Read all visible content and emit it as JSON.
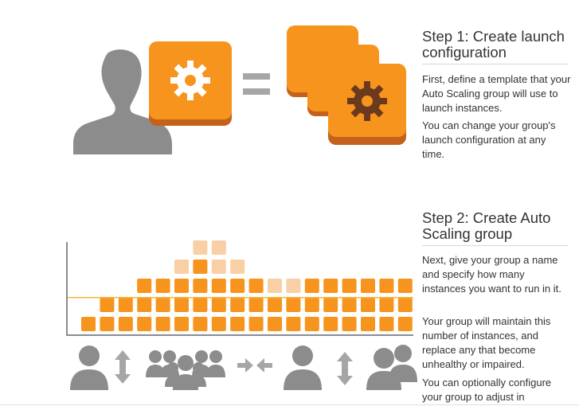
{
  "step1": {
    "title": "Step 1: Create launch configuration",
    "para1": "First, define a template that your Auto Scaling group will use to launch instances.",
    "para2": "You can change your group's launch configuration at any time."
  },
  "step2": {
    "title": "Step 2: Create Auto Scaling group",
    "para1": "Next, give your group a name and specify how many instances you want to run in it.",
    "para2": "Your group will maintain this number of instances, and replace any that become unhealthy or impaired.",
    "para3": "You can optionally configure your group to adjust in"
  },
  "icons": [
    "user-icon",
    "gear-icon",
    "equals-icon",
    "stacked-gears-icon",
    "person-icon",
    "up-down-arrow-icon",
    "group-icon",
    "converge-arrows-icon",
    "person-pair-icon"
  ],
  "colors": {
    "orange": "#F7941E",
    "dark_orange": "#D4761A",
    "pale_orange": "#F9CFA5",
    "gray": "#8C8C8C",
    "gear_brown": "#6B3A1E",
    "line": "#F0B73A"
  },
  "chart_data": {
    "type": "bar",
    "columns": [
      1,
      2,
      2,
      3,
      3,
      4,
      5,
      5,
      4,
      3,
      3,
      3,
      3,
      3,
      3,
      3,
      3,
      3
    ],
    "active_rows": [
      1,
      2,
      2,
      3,
      3,
      3,
      4,
      3,
      3,
      3,
      2,
      2,
      3,
      3,
      3,
      3,
      3,
      3
    ],
    "threshold": 2
  }
}
